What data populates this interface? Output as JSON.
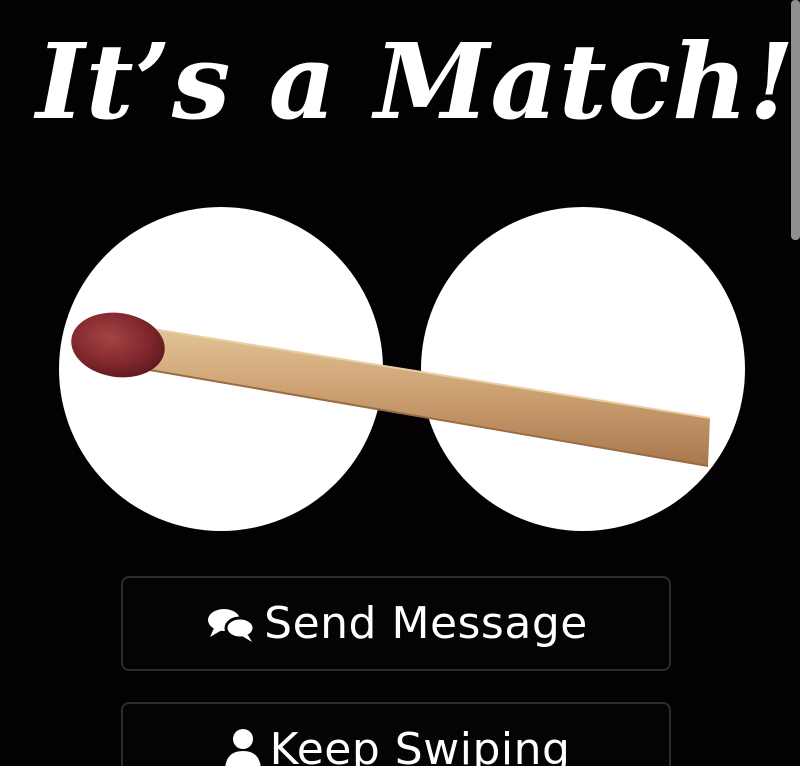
{
  "headline": "It’s a Match!",
  "buttons": {
    "send_message": "Send Message",
    "keep_swiping": "Keep Swiping"
  },
  "icons": {
    "send_message": "chat-bubbles-icon",
    "keep_swiping": "person-icon"
  },
  "colors": {
    "background": "#030103",
    "text": "#ffffff",
    "button_border": "#2e2c2e",
    "match_head": "#8a2b2f",
    "match_stick": "#c99e6e"
  }
}
